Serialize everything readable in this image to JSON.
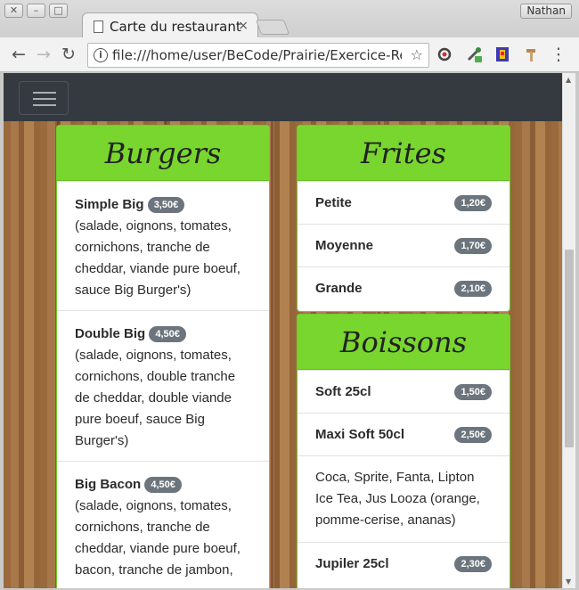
{
  "window": {
    "user": "Nathan"
  },
  "tab": {
    "title": "Carte du restaurant",
    "close": "×"
  },
  "toolbar": {
    "back": "←",
    "forward": "→",
    "reload": "↻",
    "url": "file:///home/user/BeCode/Prairie/Exercice-Resta...",
    "star": "☆",
    "menu": "⋮"
  },
  "colors": {
    "navbar": "#343a40",
    "card_header": "#79d62f",
    "badge": "#6c757d"
  },
  "menu": {
    "burgers": {
      "title": "Burgers",
      "items": [
        {
          "name": "Simple Big",
          "price": "3,50€",
          "desc": [
            "(salade, oignons, tomates,",
            "cornichons, tranche de",
            "cheddar, viande pure boeuf,",
            "sauce Big Burger's)"
          ]
        },
        {
          "name": "Double Big",
          "price": "4,50€",
          "desc": [
            "(salade, oignons, tomates,",
            "cornichons, double tranche",
            "de cheddar, double viande",
            "pure boeuf, sauce Big",
            "Burger's)"
          ]
        },
        {
          "name": "Big Bacon",
          "price": "4,50€",
          "desc": [
            "(salade, oignons, tomates,",
            "cornichons, tranche de",
            "cheddar, viande pure boeuf,",
            "bacon, tranche de jambon,"
          ]
        }
      ]
    },
    "frites": {
      "title": "Frites",
      "items": [
        {
          "name": "Petite",
          "price": "1,20€"
        },
        {
          "name": "Moyenne",
          "price": "1,70€"
        },
        {
          "name": "Grande",
          "price": "2,10€"
        }
      ]
    },
    "boissons": {
      "title": "Boissons",
      "items": [
        {
          "name": "Soft 25cl",
          "price": "1,50€"
        },
        {
          "name": "Maxi Soft 50cl",
          "price": "2,50€"
        }
      ],
      "note": [
        "Coca, Sprite, Fanta, Lipton",
        "Ice Tea, Jus Looza (orange,",
        "pomme-cerise, ananas)"
      ],
      "extra": {
        "name": "Jupiler 25cl",
        "price": "2,30€"
      }
    }
  }
}
